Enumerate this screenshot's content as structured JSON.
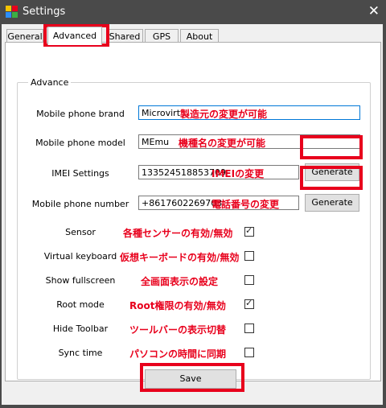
{
  "window": {
    "title": "Settings",
    "close_icon": "close-icon"
  },
  "tabs": [
    {
      "label": "General",
      "active": false
    },
    {
      "label": "Advanced",
      "active": true
    },
    {
      "label": "Shared",
      "active": false
    },
    {
      "label": "GPS",
      "active": false
    },
    {
      "label": "About",
      "active": false
    }
  ],
  "group": {
    "label": "Advance"
  },
  "fields": {
    "brand": {
      "label": "Mobile phone brand",
      "value": "Microvirt",
      "note": "製造元の変更が可能"
    },
    "model": {
      "label": "Mobile phone model",
      "value": "MEmu",
      "note": "機種名の変更が可能"
    },
    "imei": {
      "label": "IMEI Settings",
      "value": "133524518853709",
      "note": "IMEIの変更",
      "button": "Generate"
    },
    "number": {
      "label": "Mobile phone number",
      "value": "+8617602269703",
      "note": "電話番号の変更",
      "button": "Generate"
    }
  },
  "checks": [
    {
      "label": "Sensor",
      "note": "各種センサーの有効/無効",
      "checked": true
    },
    {
      "label": "Virtual keyboard",
      "note": "仮想キーボードの有効/無効",
      "checked": false
    },
    {
      "label": "Show fullscreen",
      "note": "全画面表示の設定",
      "checked": false
    },
    {
      "label": "Root mode",
      "note": "Root権限の有効/無効",
      "checked": true
    },
    {
      "label": "Hide Toolbar",
      "note": "ツールバーの表示切替",
      "checked": false
    },
    {
      "label": "Sync time",
      "note": "パソコンの時間に同期",
      "checked": false
    }
  ],
  "save_label": "Save",
  "colors": {
    "titlebar": "#4a4a4a",
    "highlight": "#e8001c",
    "focus": "#0078d7"
  }
}
